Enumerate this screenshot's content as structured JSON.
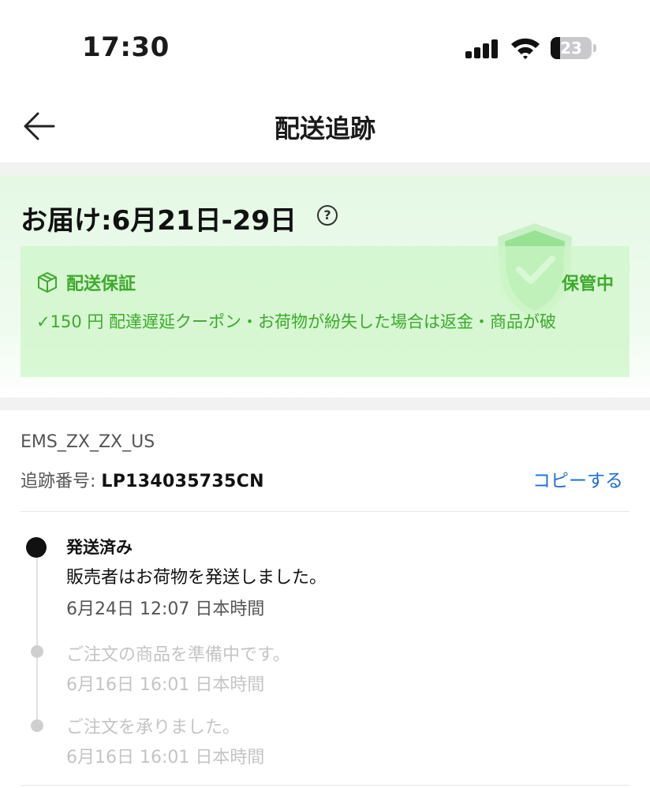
{
  "status_bar": {
    "time": "17:30",
    "battery": "23",
    "battery_level": 0.23
  },
  "nav": {
    "title": "配送追跡"
  },
  "delivery": {
    "title": "お届け:6月21日-29日",
    "guarantee_title": "配送保証",
    "guarantee_status": "保管中",
    "guarantee_desc": "✓150 円 配達遅延クーポン・お荷物が紛失した場合は返金・商品が破"
  },
  "shipping": {
    "carrier": "EMS_ZX_ZX_US",
    "tracking_label": "追跡番号:",
    "tracking_number": "LP134035735CN",
    "copy_label": "コピーする"
  },
  "timeline": [
    {
      "status": "発送済み",
      "message": "販売者はお荷物を発送しました。",
      "time": "6月24日 12:07 日本時間"
    },
    {
      "message": "ご注文の商品を準備中です。",
      "time": "6月16日 16:01 日本時間"
    },
    {
      "message": "ご注文を承りました。",
      "time": "6月16日 16:01 日本時間"
    }
  ],
  "colors": {
    "guarantee_green": "#3daa2c",
    "link_blue": "#1f6fd6",
    "banner_bg": "#e4f8e4"
  }
}
